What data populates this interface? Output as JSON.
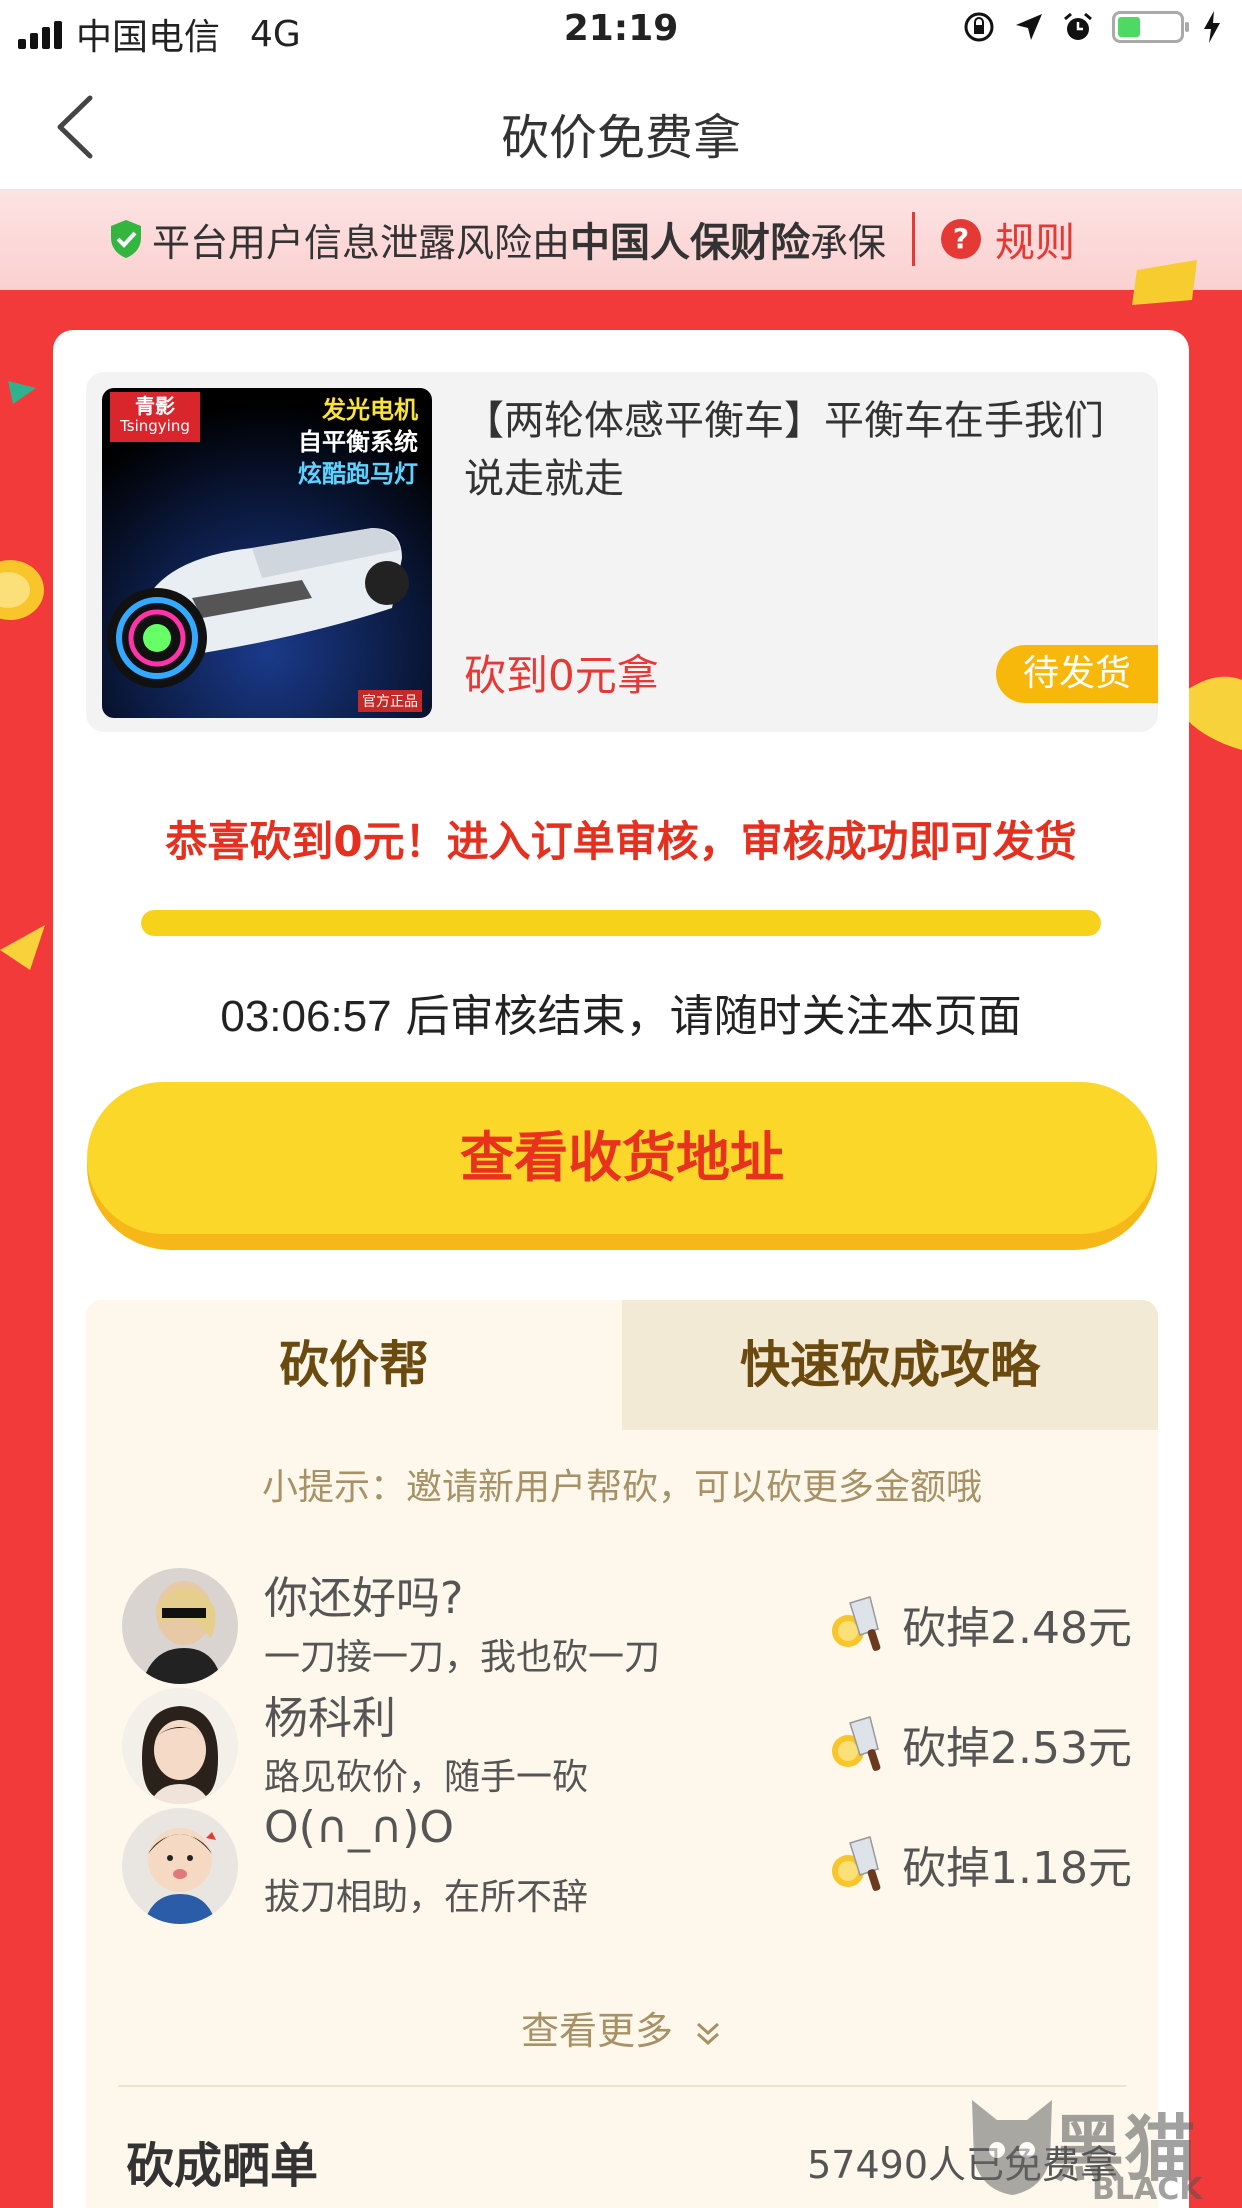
{
  "status_bar": {
    "carrier": "中国电信",
    "network": "4G",
    "time": "21:19"
  },
  "nav": {
    "title": "砍价免费拿"
  },
  "banner": {
    "text_prefix": "平台用户信息泄露风险由",
    "insurer": "中国人保财险",
    "text_suffix": "承保",
    "rules_label": "规则"
  },
  "product": {
    "title": "【两轮体感平衡车】平衡车在手我们说走就走",
    "price_label": "砍到0元拿",
    "status_label": "待发货",
    "image": {
      "brand_cn": "青影",
      "brand_en": "Tsingying",
      "features": [
        "发光电机",
        "自平衡系统",
        "炫酷跑马灯"
      ],
      "badge": "官方正品"
    }
  },
  "congrats_text": "恭喜砍到0元！进入订单审核，审核成功即可发货",
  "progress_percent": 100,
  "countdown": {
    "time": "03:06:57",
    "text": " 后审核结束，请随时关注本页面"
  },
  "address_button_label": "查看收货地址",
  "tabs": {
    "tab1": "砍价帮",
    "tab2": "快速砍成攻略"
  },
  "tip_text": "小提示：邀请新用户帮砍，可以砍更多金额哦",
  "helpers": [
    {
      "name": "你还好吗?",
      "message": "一刀接一刀，我也砍一刀",
      "amount": "砍掉2.48元"
    },
    {
      "name": "杨科利",
      "message": "路见砍价，随手一砍",
      "amount": "砍掉2.53元"
    },
    {
      "name": "O(∩_∩)O",
      "message": "拔刀相助，在所不辞",
      "amount": "砍掉1.18元"
    }
  ],
  "view_more_label": "查看更多",
  "showcase": {
    "title": "砍成晒单",
    "count_text": "57490人已免费拿"
  },
  "watermark": {
    "cn": "黑猫",
    "en": "BLACK CAT"
  },
  "colors": {
    "accent_red": "#e53935",
    "button_yellow": "#fad728",
    "page_red": "#f33a3a"
  }
}
